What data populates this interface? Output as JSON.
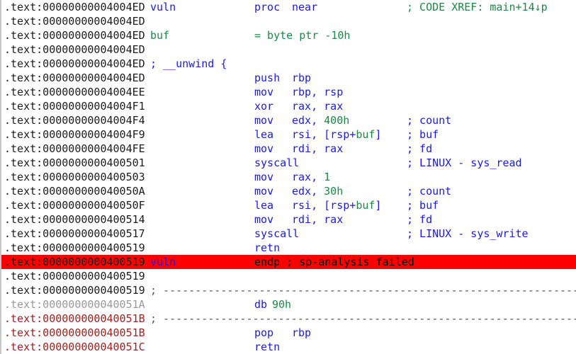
{
  "view": {
    "title": "IDA Pro disassembly — IDA View-A",
    "segment": ".text",
    "function": "vuln",
    "colors": {
      "background": "#ffffff",
      "address": "#1c1c1c",
      "address_dimmed": "#9a9a9a",
      "address_red": "#a52020",
      "mnemonic": "#1a1aee",
      "name": "#1a1aee",
      "number": "#1a8a46",
      "comment_auto": "#1a1aee",
      "comment_xref": "#1a8a46",
      "highlight_background": "#ff0000",
      "separator": "#555555"
    }
  },
  "lines": [
    {
      "addr": ".text:00000000004004ED",
      "addr_style": "normal",
      "label": "vuln",
      "label_style": "name",
      "mnemonic": "proc",
      "mnemonic_style": "kw",
      "operands": "near",
      "operands_style": "kw",
      "comment": "; CODE XREF: main+14↓p",
      "comment_style": "xref",
      "highlight": false
    },
    {
      "addr": ".text:00000000004004ED",
      "addr_style": "normal",
      "label": "",
      "mnemonic": "",
      "operands": "",
      "comment": "",
      "highlight": false
    },
    {
      "addr": ".text:00000000004004ED",
      "addr_style": "normal",
      "label": "buf",
      "label_style": "num",
      "mnemonic": "= byte",
      "mnemonic_style": "num",
      "operands": "",
      "comment": "",
      "highlight": false,
      "raw_right": "= byte ptr -10h",
      "raw_right_style": "num"
    },
    {
      "addr": ".text:00000000004004ED",
      "addr_style": "normal",
      "label": "",
      "mnemonic": "",
      "operands": "",
      "comment": "",
      "highlight": false
    },
    {
      "addr": ".text:00000000004004ED",
      "addr_style": "normal",
      "label": "; __unwind {",
      "label_style": "cmt-blue",
      "mnemonic": "",
      "operands": "",
      "comment": "",
      "highlight": false
    },
    {
      "addr": ".text:00000000004004ED",
      "addr_style": "normal",
      "label": "",
      "mnemonic": "push",
      "mnemonic_style": "mnem",
      "operands": "rbp",
      "operands_style": "op",
      "comment": "",
      "highlight": false
    },
    {
      "addr": ".text:00000000004004EE",
      "addr_style": "normal",
      "label": "",
      "mnemonic": "mov",
      "mnemonic_style": "mnem",
      "operands": "rbp, rsp",
      "operands_style": "op",
      "comment": "",
      "highlight": false
    },
    {
      "addr": ".text:00000000004004F1",
      "addr_style": "normal",
      "label": "",
      "mnemonic": "xor",
      "mnemonic_style": "mnem",
      "operands": "rax, rax",
      "operands_style": "op",
      "comment": "",
      "highlight": false
    },
    {
      "addr": ".text:00000000004004F4",
      "addr_style": "normal",
      "label": "",
      "mnemonic": "mov",
      "mnemonic_style": "mnem",
      "operands_html": "edx, <span class=\"c-num\">400h</span>",
      "comment": "; count",
      "comment_style": "auto",
      "highlight": false
    },
    {
      "addr": ".text:00000000004004F9",
      "addr_style": "normal",
      "label": "",
      "mnemonic": "lea",
      "mnemonic_style": "mnem",
      "operands_html": "rsi, [rsp+<span class=\"c-num\">buf</span>]",
      "comment": "; buf",
      "comment_style": "auto",
      "highlight": false
    },
    {
      "addr": ".text:00000000004004FE",
      "addr_style": "normal",
      "label": "",
      "mnemonic": "mov",
      "mnemonic_style": "mnem",
      "operands": "rdi, rax",
      "operands_style": "op",
      "comment": "; fd",
      "comment_style": "auto",
      "highlight": false
    },
    {
      "addr": ".text:0000000000400501",
      "addr_style": "normal",
      "label": "",
      "mnemonic": "syscall",
      "mnemonic_style": "mnem",
      "operands": "",
      "comment": "; LINUX - sys_read",
      "comment_style": "auto",
      "highlight": false
    },
    {
      "addr": ".text:0000000000400503",
      "addr_style": "normal",
      "label": "",
      "mnemonic": "mov",
      "mnemonic_style": "mnem",
      "operands_html": "rax, <span class=\"c-num\">1</span>",
      "comment": "",
      "highlight": false
    },
    {
      "addr": ".text:000000000040050A",
      "addr_style": "normal",
      "label": "",
      "mnemonic": "mov",
      "mnemonic_style": "mnem",
      "operands_html": "edx, <span class=\"c-num\">30h</span>",
      "comment": "; count",
      "comment_style": "auto",
      "highlight": false
    },
    {
      "addr": ".text:000000000040050F",
      "addr_style": "normal",
      "label": "",
      "mnemonic": "lea",
      "mnemonic_style": "mnem",
      "operands_html": "rsi, [rsp+<span class=\"c-num\">buf</span>]",
      "comment": "; buf",
      "comment_style": "auto",
      "highlight": false
    },
    {
      "addr": ".text:0000000000400514",
      "addr_style": "normal",
      "label": "",
      "mnemonic": "mov",
      "mnemonic_style": "mnem",
      "operands": "rdi, rax",
      "operands_style": "op",
      "comment": "; fd",
      "comment_style": "auto",
      "highlight": false
    },
    {
      "addr": ".text:0000000000400517",
      "addr_style": "normal",
      "label": "",
      "mnemonic": "syscall",
      "mnemonic_style": "mnem",
      "operands": "",
      "comment": "; LINUX - sys_write",
      "comment_style": "auto",
      "highlight": false
    },
    {
      "addr": ".text:0000000000400519",
      "addr_style": "normal",
      "label": "",
      "mnemonic": "retn",
      "mnemonic_style": "mnem",
      "operands": "",
      "comment": "",
      "highlight": false
    },
    {
      "addr": ".text:0000000000400519",
      "addr_style": "normal",
      "label": "vuln",
      "label_style": "name",
      "mnemonic": "endp ; sp-analysis failed",
      "mnemonic_style": "black",
      "operands": "",
      "comment": "",
      "highlight": true
    },
    {
      "addr": ".text:0000000000400519",
      "addr_style": "normal",
      "label": "",
      "mnemonic": "",
      "operands": "",
      "comment": "",
      "highlight": false
    },
    {
      "addr": ".text:0000000000400519",
      "addr_style": "normal",
      "label": "; ---------------------------------------------------------------------------",
      "label_style": "dash",
      "mnemonic": "",
      "operands": "",
      "comment": "",
      "highlight": false
    },
    {
      "addr": ".text:000000000040051A",
      "addr_style": "dimmed",
      "label": "",
      "mnemonic": "db",
      "mnemonic_style": "mnem",
      "operands_html": "<span class=\"c-num\">90h</span>",
      "operand_offset": "db-col",
      "comment": "",
      "highlight": false
    },
    {
      "addr": ".text:000000000040051B",
      "addr_style": "red",
      "label": "; ---------------------------------------------------------------------------",
      "label_style": "dash",
      "mnemonic": "",
      "operands": "",
      "comment": "",
      "highlight": false
    },
    {
      "addr": ".text:000000000040051B",
      "addr_style": "red",
      "label": "",
      "mnemonic": "pop",
      "mnemonic_style": "mnem",
      "operands": "rbp",
      "operands_style": "op",
      "comment": "",
      "highlight": false
    },
    {
      "addr": ".text:000000000040051C",
      "addr_style": "red",
      "label": "",
      "mnemonic": "retn",
      "mnemonic_style": "mnem",
      "operands": "",
      "comment": "",
      "highlight": false
    }
  ]
}
